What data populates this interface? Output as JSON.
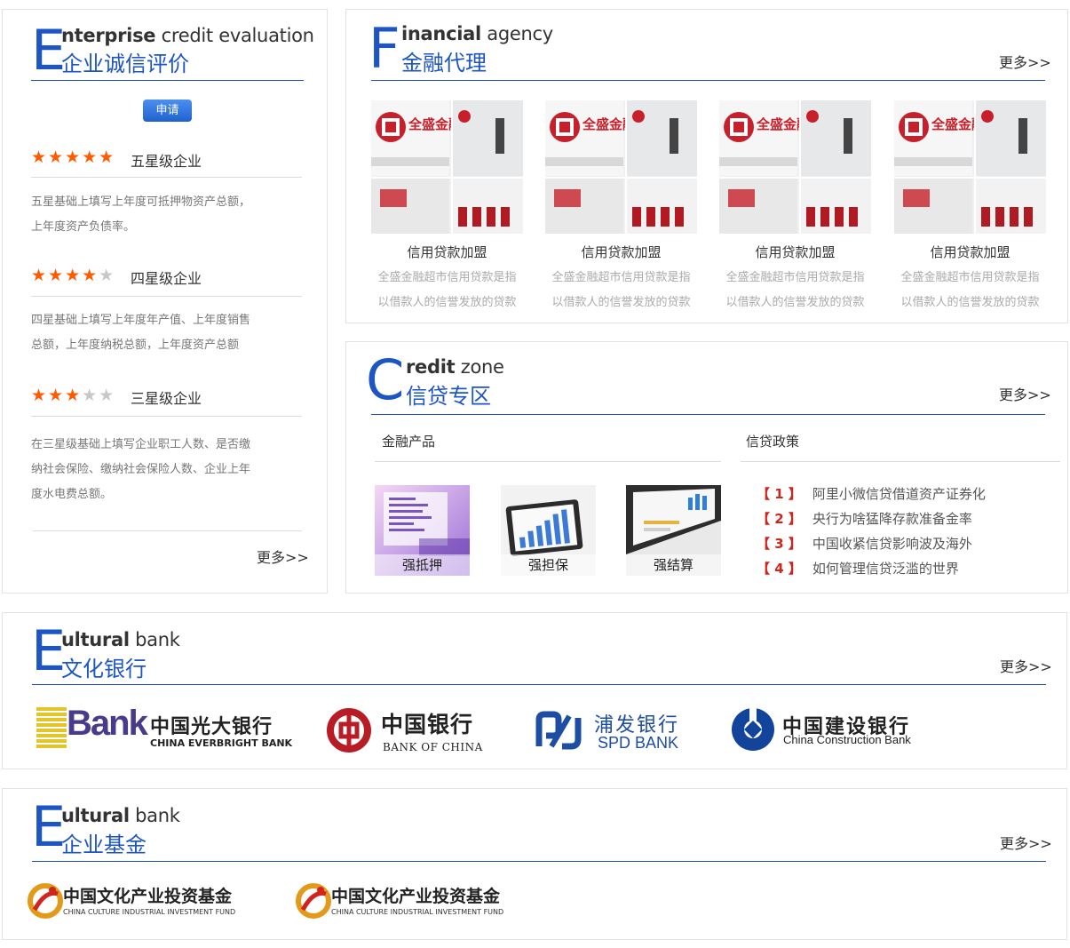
{
  "enterprise": {
    "big": "E",
    "en_bold": "nterprise",
    "en_rest": " credit evaluation",
    "zh": "企业诚信评价",
    "apply": "申请",
    "levels": [
      {
        "rating": 5,
        "stars": "★★★★★",
        "title": "五星级企业",
        "desc": [
          "五星基础上填写上年度可抵押物资产总额，",
          "上年度资产负债率。"
        ]
      },
      {
        "rating": 4,
        "stars": "★★★★★",
        "title": "四星级企业",
        "desc": [
          "四星基础上填写上年度年产值、上年度销售",
          "总额，上年度纳税总额，上年度资产总额"
        ]
      },
      {
        "rating": 3,
        "stars": "★★★★★",
        "title": "三星级企业",
        "desc": [
          "在三星级基础上填写企业职工人数、是否缴",
          "纳社会保险、缴纳社会保险人数、企业上年",
          "度水电费总额。"
        ]
      }
    ],
    "more": "更多>>"
  },
  "financial": {
    "big": "F",
    "en_bold": "inancial",
    "en_rest": " agency",
    "zh": "金融代理",
    "more": "更多>>",
    "cards": [
      {
        "title": "信用贷款加盟",
        "desc": [
          "全盛金融超市信用贷款是指",
          "以借款人的信誉发放的贷款"
        ],
        "logo_text": "全盛金融"
      },
      {
        "title": "信用贷款加盟",
        "desc": [
          "全盛金融超市信用贷款是指",
          "以借款人的信誉发放的贷款"
        ],
        "logo_text": "全盛金融"
      },
      {
        "title": "信用贷款加盟",
        "desc": [
          "全盛金融超市信用贷款是指",
          "以借款人的信誉发放的贷款"
        ],
        "logo_text": "全盛金融"
      },
      {
        "title": "信用贷款加盟",
        "desc": [
          "全盛金融超市信用贷款是指",
          "以借款人的信誉发放的贷款"
        ],
        "logo_text": "全盛金融"
      }
    ]
  },
  "credit": {
    "big": "C",
    "en_bold": "redit",
    "en_rest": " zone",
    "zh": "信贷专区",
    "more": "更多>>",
    "products_title": "金融产品",
    "policy_title": "信贷政策",
    "products": [
      {
        "label": "强抵押"
      },
      {
        "label": "强担保"
      },
      {
        "label": "强结算"
      }
    ],
    "policies": [
      {
        "num": "【 1 】",
        "text": "阿里小微信贷借道资产证券化"
      },
      {
        "num": "【 2 】",
        "text": "央行为啥猛降存款准备金率"
      },
      {
        "num": "【 3 】",
        "text": "中国收紧信贷影响波及海外"
      },
      {
        "num": "【 4 】",
        "text": "如何管理信贷泛滥的世界"
      }
    ]
  },
  "cultural": {
    "big": "E",
    "en_bold": "ultural",
    "en_rest": " bank",
    "zh": "文化银行",
    "more": "更多>>",
    "banks": [
      {
        "name": "中国光大银行",
        "sub": "CHINA EVERBRIGHT BANK",
        "mark": "Bank"
      },
      {
        "name": "中国银行",
        "sub": "BANK OF CHINA"
      },
      {
        "name": "浦发银行",
        "sub": "SPD BANK"
      },
      {
        "name": "中国建设银行",
        "sub": "China Construction Bank"
      }
    ]
  },
  "fund": {
    "big": "E",
    "en_bold": "ultural",
    "en_rest": " bank",
    "zh": "企业基金",
    "more": "更多>>",
    "funds": [
      {
        "name": "中国文化产业投资基金",
        "sub": "CHINA CULTURE INDUSTRIAL INVESTMENT FUND"
      },
      {
        "name": "中国文化产业投资基金",
        "sub": "CHINA CULTURE INDUSTRIAL INVESTMENT FUND"
      }
    ]
  },
  "colors": {
    "brand_blue": "#1d55c4",
    "star_on": "#ff5a00",
    "star_off": "#c8c8c8",
    "policy_num": "#d0241c"
  }
}
